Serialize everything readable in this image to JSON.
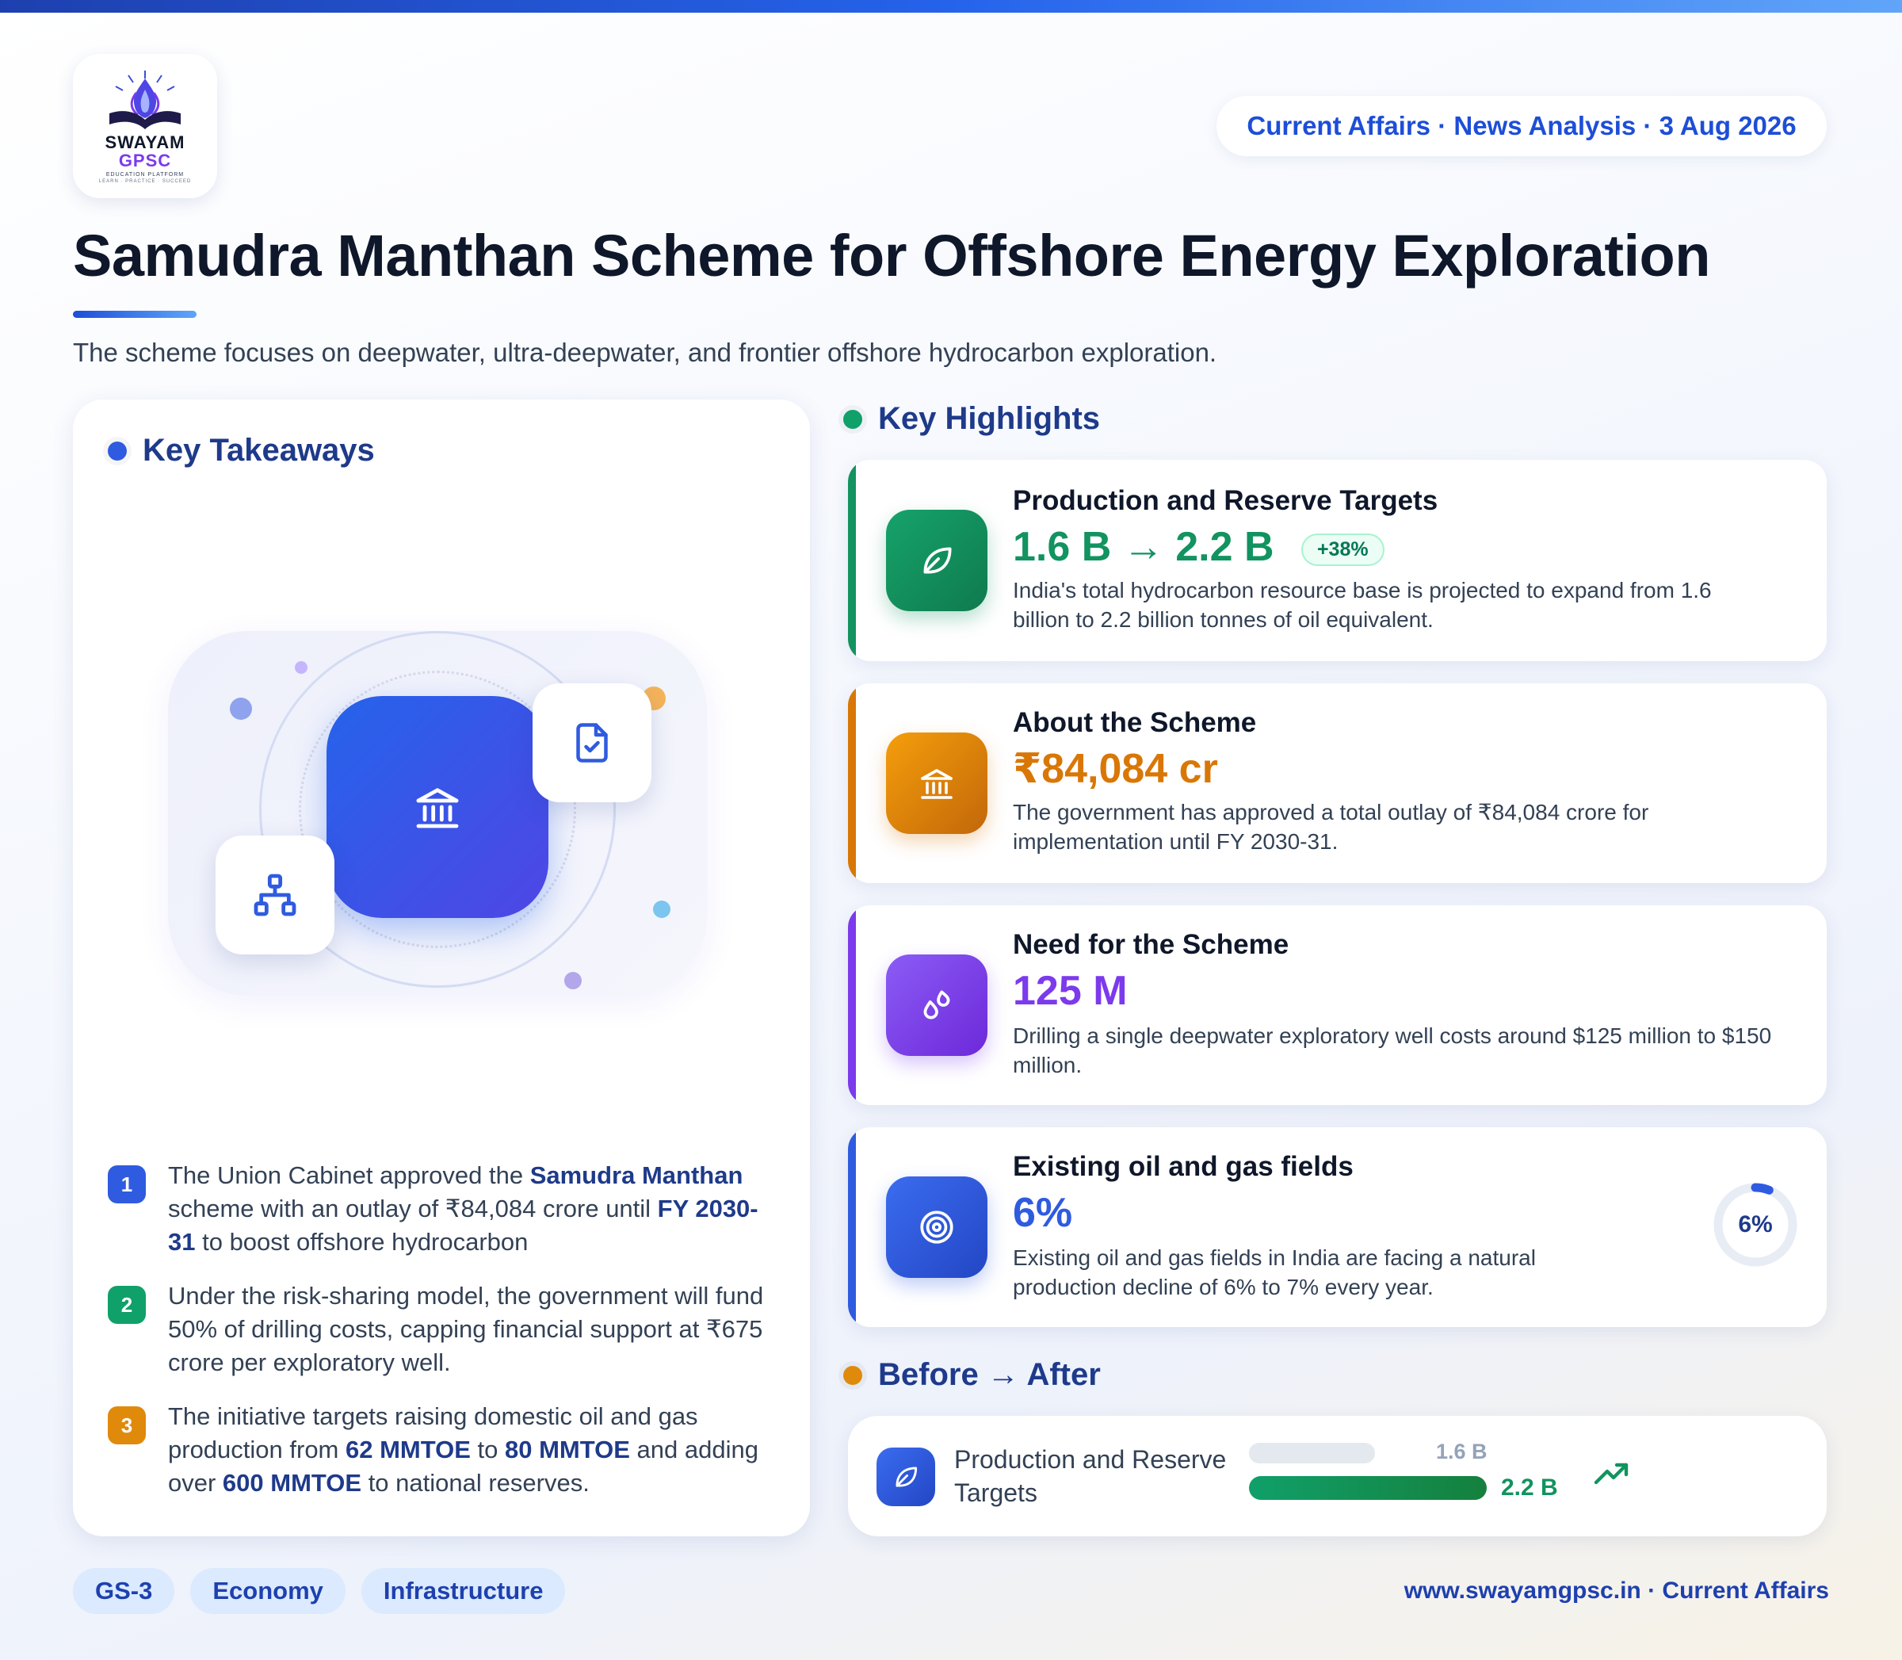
{
  "brand": {
    "name_line1": "SWAYAM",
    "name_line2": "GPSC",
    "tagline": "EDUCATION PLATFORM",
    "motto": "LEARN · PRACTICE · SUCCEED"
  },
  "header": {
    "meta": "Current Affairs · News Analysis · 3 Aug 2026"
  },
  "title": "Samudra Manthan Scheme for Offshore Energy Exploration",
  "subtitle": "The scheme focuses on deepwater, ultra-deepwater, and frontier offshore hydrocarbon exploration.",
  "takeaways": {
    "heading": "Key Takeaways",
    "items": [
      {
        "num": "1",
        "color": "#2f5be0"
      },
      {
        "num": "2",
        "color": "#10a06a"
      },
      {
        "num": "3",
        "color": "#e08a0b"
      }
    ]
  },
  "highlights": {
    "heading": "Key Highlights",
    "cards": [
      {
        "title": "Production and Reserve Targets",
        "value_from": "1.6 B",
        "value_to": "2.2 B",
        "badge": "+38%",
        "desc": "India's total hydrocarbon resource base is projected to expand from 1.6 billion to 2.2 billion tonnes of oil equivalent.",
        "icon": "leaf-icon",
        "color": "#12935f"
      },
      {
        "title": "About the Scheme",
        "value": "₹84,084 cr",
        "desc": "The government has approved a total outlay of ₹84,084 crore for implementation until FY 2030-31.",
        "icon": "bank-icon",
        "color": "#d97706"
      },
      {
        "title": "Need for the Scheme",
        "value": "125 M",
        "desc": "Drilling a single deepwater exploratory well costs around $125 million to $150 million.",
        "icon": "droplets-icon",
        "color": "#7c3aed"
      },
      {
        "title": "Existing oil and gas fields",
        "value": "6%",
        "desc": "Existing oil and gas fields in India are facing a natural production decline of 6% to 7% every year.",
        "icon": "target-icon",
        "color": "#2f5be0",
        "gauge_label": "6%",
        "gauge_fraction": 0.06
      }
    ]
  },
  "before_after": {
    "heading": "Before → After",
    "label": "Production and Reserve Targets",
    "before": {
      "label": "1.6 B",
      "value": 1.6
    },
    "after": {
      "label": "2.2 B",
      "value": 2.2
    }
  },
  "tags": [
    "GS-3",
    "Economy",
    "Infrastructure"
  ],
  "footer": "www.swayamgpsc.in · Current Affairs"
}
